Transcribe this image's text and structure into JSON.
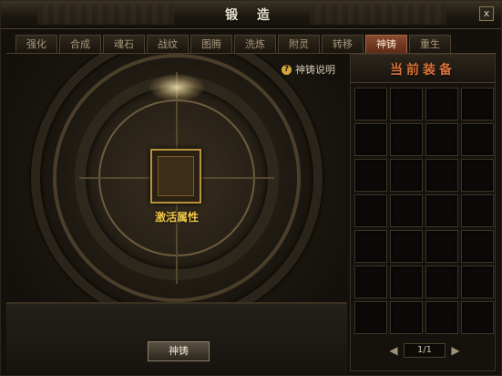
{
  "window": {
    "title": "锻 造",
    "close_label": "x"
  },
  "tabs": [
    {
      "label": "强化"
    },
    {
      "label": "合成"
    },
    {
      "label": "魂石"
    },
    {
      "label": "战纹"
    },
    {
      "label": "图腾"
    },
    {
      "label": "洗炼"
    },
    {
      "label": "附灵"
    },
    {
      "label": "转移"
    },
    {
      "label": "神铸"
    },
    {
      "label": "重生"
    }
  ],
  "active_tab": "神铸",
  "help": {
    "label": "神铸说明",
    "icon": "question-icon"
  },
  "slot": {
    "label": "激活属性"
  },
  "action": {
    "label": "神铸"
  },
  "equipment": {
    "title": "当前装备",
    "pager": {
      "current": "1/1",
      "prev_icon": "arrow-left-icon",
      "next_icon": "arrow-right-icon"
    }
  },
  "colors": {
    "active_tab": "#8a4a2d",
    "label_gold": "#f1c84a",
    "equip_title": "#d8723a"
  }
}
